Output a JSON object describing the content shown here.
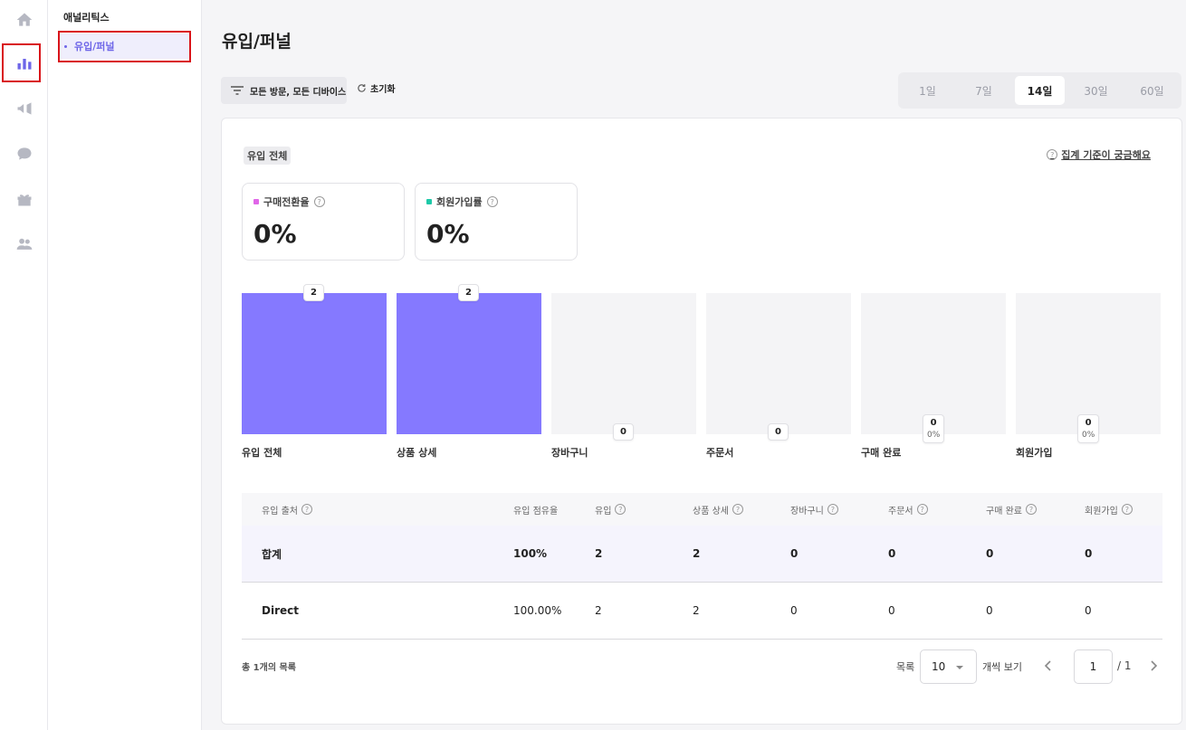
{
  "rail": {
    "items": [
      {
        "name": "home-icon"
      },
      {
        "name": "bar-chart-icon",
        "active": true
      },
      {
        "name": "megaphone-icon"
      },
      {
        "name": "chat-bubble-icon"
      },
      {
        "name": "gift-icon"
      },
      {
        "name": "users-icon"
      }
    ]
  },
  "subnav": {
    "title": "애널리틱스",
    "active_item": "유입/퍼널"
  },
  "header": {
    "title": "유입/퍼널",
    "filter_label": "모든 방문, 모든 디바이스",
    "reset_label": "초기화",
    "ranges": [
      "1일",
      "7일",
      "14일",
      "30일",
      "60일"
    ],
    "selected_range": "14일"
  },
  "summary": {
    "section_label": "유입 전체",
    "criteria_link": "집계 기준이 궁금해요",
    "kpis": [
      {
        "label": "구매전환율",
        "value": "0%",
        "color": "#e066e8"
      },
      {
        "label": "회원가입률",
        "value": "0%",
        "color": "#1ec9a8"
      }
    ]
  },
  "funnel": {
    "max": 2,
    "accent": "#8579ff",
    "steps": [
      {
        "label": "유입 전체",
        "value": 2,
        "display": "2"
      },
      {
        "label": "상품 상세",
        "value": 2,
        "display": "2"
      },
      {
        "label": "장바구니",
        "value": 0,
        "display": "0"
      },
      {
        "label": "주문서",
        "value": 0,
        "display": "0"
      },
      {
        "label": "구매 완료",
        "value": 0,
        "display": "0",
        "pct": "0%"
      },
      {
        "label": "회원가입",
        "value": 0,
        "display": "0",
        "pct": "0%"
      }
    ]
  },
  "table": {
    "headers": [
      "유입 출처",
      "유입 점유율",
      "유입",
      "상품 상세",
      "장바구니",
      "주문서",
      "구매 완료",
      "회원가입"
    ],
    "total_row": [
      "합계",
      "100%",
      "2",
      "2",
      "0",
      "0",
      "0",
      "0"
    ],
    "rows": [
      [
        "Direct",
        "100.00%",
        "2",
        "2",
        "0",
        "0",
        "0",
        "0"
      ]
    ]
  },
  "pagination": {
    "total_text": "총 1개의 목록",
    "list_label": "목록",
    "page_size": "10",
    "per_page_label": "개씩 보기",
    "current_page": "1",
    "total_pages": "/ 1"
  }
}
